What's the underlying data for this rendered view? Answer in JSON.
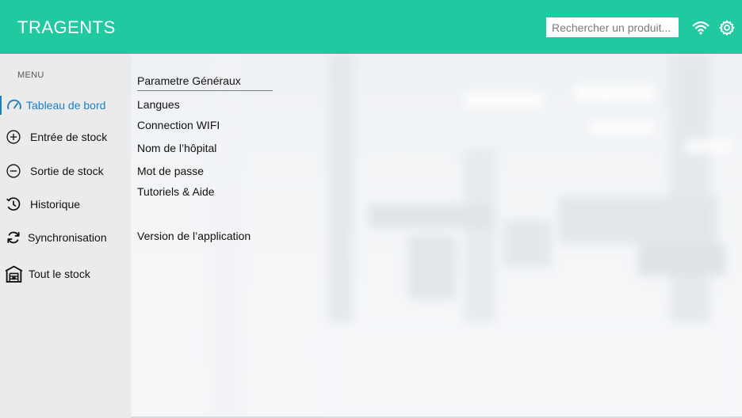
{
  "app": {
    "title": "TRAGENTS"
  },
  "header": {
    "search_placeholder": "Rechercher un produit...",
    "icons": [
      "wifi-icon",
      "gear-icon"
    ]
  },
  "sidebar": {
    "menu_label": "MENU",
    "items": [
      {
        "label": "Tableau de bord",
        "icon": "dashboard-gauge-icon",
        "active": true
      },
      {
        "label": "Entrée de stock",
        "icon": "plus-circle-icon",
        "active": false
      },
      {
        "label": "Sortie de stock",
        "icon": "minus-circle-icon",
        "active": false
      },
      {
        "label": "Historique",
        "icon": "history-icon",
        "active": false
      },
      {
        "label": "Synchronisation",
        "icon": "sync-icon",
        "active": false
      },
      {
        "label": "Tout le stock",
        "icon": "warehouse-icon",
        "active": false
      }
    ]
  },
  "settings": {
    "header": "Parametre Généraux",
    "items": [
      "Langues",
      "Connection  WIFI",
      "Nom de l’hôpital",
      "Mot de passe",
      "Tutoriels & Aide",
      "Version de l’application"
    ]
  },
  "colors": {
    "accent": "#20c9a0",
    "active": "#1a7fc4",
    "sidebar_bg": "#ebebeb"
  }
}
